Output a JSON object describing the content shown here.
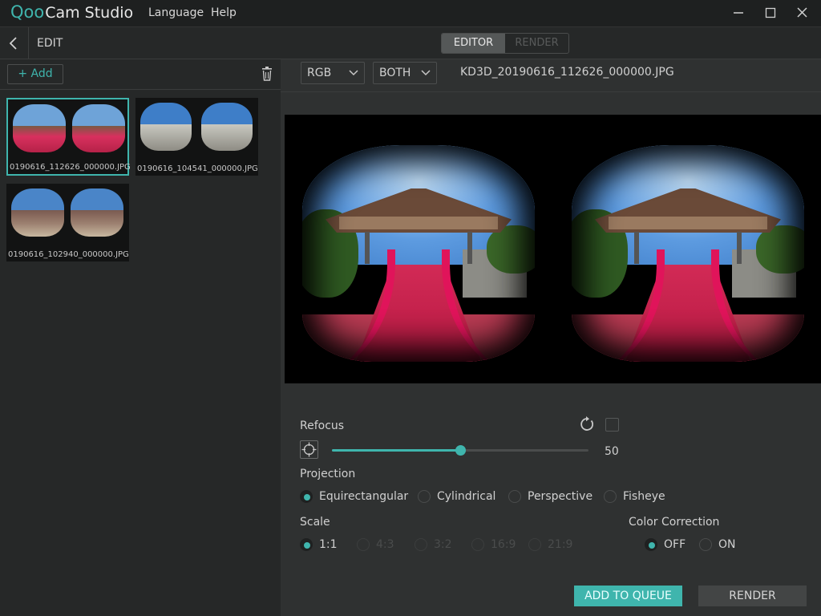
{
  "app": {
    "logo_q": "Qoo",
    "logo_cam": "Cam",
    "logo_studio": "Studio",
    "menu": [
      "Language",
      "Help"
    ]
  },
  "editbar": {
    "title": "EDIT",
    "tabs": [
      "EDITOR",
      "RENDER"
    ],
    "active_tab": "EDITOR"
  },
  "library": {
    "add_label": "+ Add",
    "items": [
      {
        "name": "0190616_112626_000000.JPG",
        "selected": true
      },
      {
        "name": "0190616_104541_000000.JPG",
        "selected": false
      },
      {
        "name": "0190616_102940_000000.JPG",
        "selected": false
      }
    ]
  },
  "toolbar": {
    "color_mode": "RGB",
    "eye_mode": "BOTH",
    "filename": "KD3D_20190616_112626_000000.JPG"
  },
  "refocus": {
    "label": "Refocus",
    "value": "50",
    "fraction": 0.5
  },
  "projection": {
    "label": "Projection",
    "options": [
      "Equirectangular",
      "Cylindrical",
      "Perspective",
      "Fisheye"
    ],
    "selected": "Equirectangular"
  },
  "scale": {
    "label": "Scale",
    "options": [
      "1:1",
      "4:3",
      "3:2",
      "16:9",
      "21:9"
    ],
    "selected": "1:1"
  },
  "color_correction": {
    "label": "Color Correction",
    "options": [
      "OFF",
      "ON"
    ],
    "selected": "OFF"
  },
  "actions": {
    "queue": "ADD TO QUEUE",
    "render": "RENDER"
  },
  "colors": {
    "accent": "#3fb5ad",
    "panel": "#2f3131",
    "sidebar": "#262828"
  }
}
